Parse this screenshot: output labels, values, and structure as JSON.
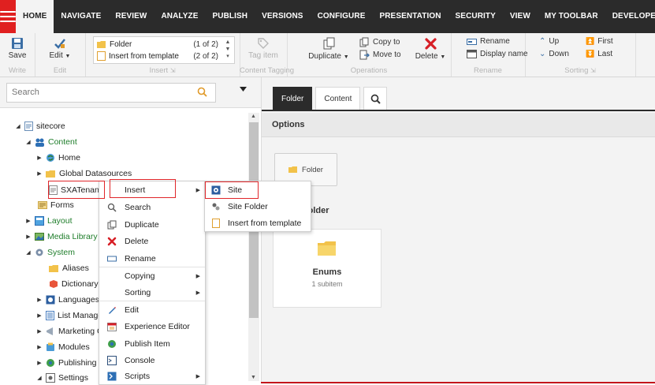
{
  "nav": {
    "tabs": [
      "HOME",
      "NAVIGATE",
      "REVIEW",
      "ANALYZE",
      "PUBLISH",
      "VERSIONS",
      "CONFIGURE",
      "PRESENTATION",
      "SECURITY",
      "VIEW",
      "MY TOOLBAR",
      "DEVELOPER"
    ],
    "active_tab": "HOME"
  },
  "ribbon": {
    "save_label": "Save",
    "write_group": "Write",
    "edit_label": "Edit",
    "edit_group": "Edit",
    "insert_items": [
      {
        "label": "Folder",
        "count": "(1 of 2)"
      },
      {
        "label": "Insert from template",
        "count": "(2 of 2)"
      }
    ],
    "insert_group": "Insert",
    "tag_item_label": "Tag item",
    "tagging_group": "Content Tagging",
    "duplicate_label": "Duplicate",
    "copy_to_label": "Copy to",
    "move_to_label": "Move to",
    "delete_label": "Delete",
    "operations_group": "Operations",
    "rename_label": "Rename",
    "display_name_label": "Display name",
    "rename_group": "Rename",
    "up_label": "Up",
    "down_label": "Down",
    "first_label": "First",
    "last_label": "Last",
    "sorting_group": "Sorting"
  },
  "search": {
    "placeholder": "Search"
  },
  "tree": [
    {
      "label": "sitecore"
    },
    {
      "label": "Content"
    },
    {
      "label": "Home"
    },
    {
      "label": "Global Datasources"
    },
    {
      "label": "SXATenant"
    },
    {
      "label": "Forms"
    },
    {
      "label": "Layout"
    },
    {
      "label": "Media Library"
    },
    {
      "label": "System"
    },
    {
      "label": "Aliases"
    },
    {
      "label": "Dictionary"
    },
    {
      "label": "Languages"
    },
    {
      "label": "List Manage"
    },
    {
      "label": "Marketing C"
    },
    {
      "label": "Modules"
    },
    {
      "label": "Publishing t"
    },
    {
      "label": "Settings"
    }
  ],
  "context_menu": {
    "items": [
      {
        "label": "Insert"
      },
      {
        "label": "Search"
      },
      {
        "label": "Duplicate"
      },
      {
        "label": "Delete"
      },
      {
        "label": "Rename"
      },
      {
        "label": "Copying"
      },
      {
        "label": "Sorting"
      },
      {
        "label": "Edit"
      },
      {
        "label": "Experience Editor"
      },
      {
        "label": "Publish Item"
      },
      {
        "label": "Console"
      },
      {
        "label": "Scripts"
      }
    ]
  },
  "submenu": {
    "items": [
      {
        "label": "Site"
      },
      {
        "label": "Site Folder"
      },
      {
        "label": "Insert from template"
      }
    ]
  },
  "content": {
    "tabs": [
      "Folder",
      "Content"
    ],
    "active_tab": "Folder",
    "options_title": "Options",
    "folder_button_label": "Folder",
    "section_title": "he Folder",
    "card_title": "Enums",
    "card_subtitle": "1 subitem"
  },
  "colors": {
    "brand_red": "#e02020",
    "nav_dark": "#2b2b2b",
    "highlight_box": "#e0262a"
  }
}
